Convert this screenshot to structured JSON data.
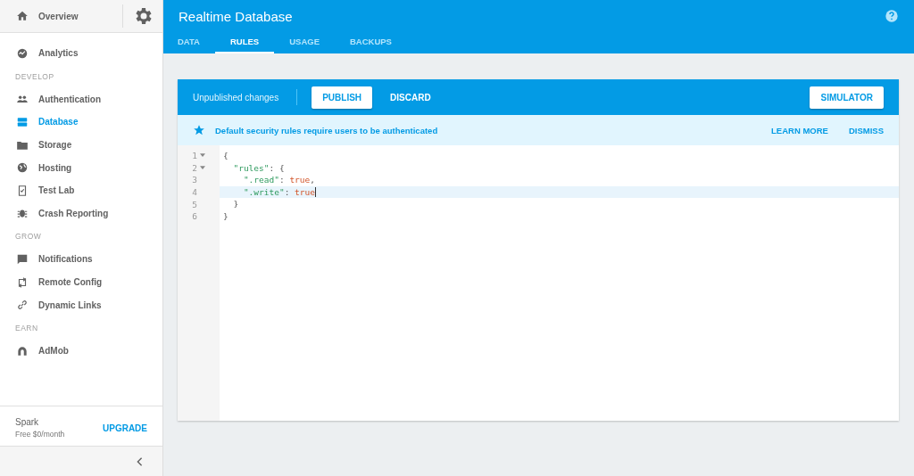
{
  "sidebar": {
    "overview": "Overview",
    "sections": [
      {
        "items": [
          {
            "label": "Analytics",
            "selected": false
          }
        ]
      },
      {
        "header": "DEVELOP",
        "items": [
          {
            "label": "Authentication",
            "selected": false
          },
          {
            "label": "Database",
            "selected": true
          },
          {
            "label": "Storage",
            "selected": false
          },
          {
            "label": "Hosting",
            "selected": false
          },
          {
            "label": "Test Lab",
            "selected": false
          },
          {
            "label": "Crash Reporting",
            "selected": false
          }
        ]
      },
      {
        "header": "GROW",
        "items": [
          {
            "label": "Notifications",
            "selected": false
          },
          {
            "label": "Remote Config",
            "selected": false
          },
          {
            "label": "Dynamic Links",
            "selected": false
          }
        ]
      },
      {
        "header": "EARN",
        "items": [
          {
            "label": "AdMob",
            "selected": false
          }
        ]
      }
    ],
    "plan": {
      "name": "Spark",
      "price": "Free $0/month",
      "action": "UPGRADE"
    }
  },
  "header": {
    "title": "Realtime Database",
    "tabs": [
      {
        "label": "DATA",
        "selected": false
      },
      {
        "label": "RULES",
        "selected": true
      },
      {
        "label": "USAGE",
        "selected": false
      },
      {
        "label": "BACKUPS",
        "selected": false
      }
    ]
  },
  "toolbar": {
    "status": "Unpublished changes",
    "publish": "PUBLISH",
    "discard": "DISCARD",
    "simulator": "SIMULATOR"
  },
  "banner": {
    "message": "Default security rules require users to be authenticated",
    "learn_more": "LEARN MORE",
    "dismiss": "DISMISS"
  },
  "editor": {
    "lines": [
      {
        "number": "1",
        "foldable": true,
        "active": false,
        "tokens": [
          {
            "text": "{",
            "kind": "punct"
          }
        ]
      },
      {
        "number": "2",
        "foldable": true,
        "active": false,
        "tokens": [
          {
            "text": "  \"rules\"",
            "kind": "key"
          },
          {
            "text": ": {",
            "kind": "punct"
          }
        ]
      },
      {
        "number": "3",
        "foldable": false,
        "active": false,
        "tokens": [
          {
            "text": "    \".read\"",
            "kind": "key"
          },
          {
            "text": ": ",
            "kind": "punct"
          },
          {
            "text": "true",
            "kind": "value"
          },
          {
            "text": ",",
            "kind": "punct"
          }
        ]
      },
      {
        "number": "4",
        "foldable": false,
        "active": true,
        "tokens": [
          {
            "text": "    \".write\"",
            "kind": "key"
          },
          {
            "text": ": ",
            "kind": "punct"
          },
          {
            "text": "true",
            "kind": "value"
          }
        ]
      },
      {
        "number": "5",
        "foldable": false,
        "active": false,
        "tokens": [
          {
            "text": "  }",
            "kind": "punct"
          }
        ]
      },
      {
        "number": "6",
        "foldable": false,
        "active": false,
        "tokens": [
          {
            "text": "}",
            "kind": "punct"
          }
        ]
      }
    ]
  }
}
